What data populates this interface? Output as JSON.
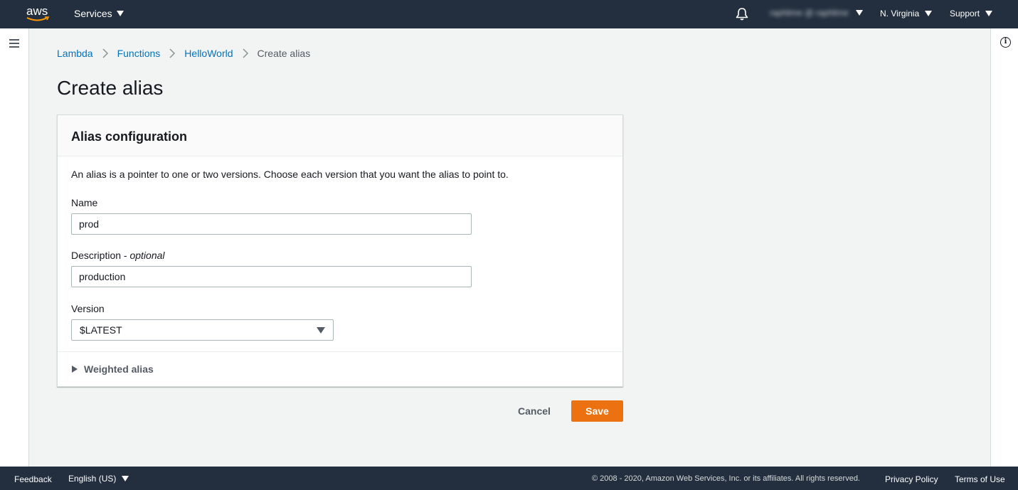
{
  "nav": {
    "logo_text": "aws",
    "services_label": "Services",
    "account_label": "raphlime @ raphlime",
    "region_label": "N. Virginia",
    "support_label": "Support"
  },
  "breadcrumb": [
    {
      "label": "Lambda"
    },
    {
      "label": "Functions"
    },
    {
      "label": "HelloWorld"
    },
    {
      "label": "Create alias"
    }
  ],
  "page": {
    "title": "Create alias"
  },
  "panel": {
    "header": "Alias configuration",
    "description": "An alias is a pointer to one or two versions. Choose each version that you want the alias to point to.",
    "name_label": "Name",
    "name_value": "prod",
    "description_label": "Description - ",
    "description_optional": "optional",
    "description_value": "production",
    "version_label": "Version",
    "version_value": "$LATEST",
    "weighted_alias_label": "Weighted alias"
  },
  "actions": {
    "cancel_label": "Cancel",
    "save_label": "Save"
  },
  "footer": {
    "feedback_label": "Feedback",
    "language_label": "English (US)",
    "copyright": "© 2008 - 2020, Amazon Web Services, Inc. or its affiliates. All rights reserved.",
    "privacy_label": "Privacy Policy",
    "terms_label": "Terms of Use"
  },
  "colors": {
    "nav_bg": "#232f3e",
    "link": "#0073bb",
    "primary_button": "#ec7211"
  }
}
